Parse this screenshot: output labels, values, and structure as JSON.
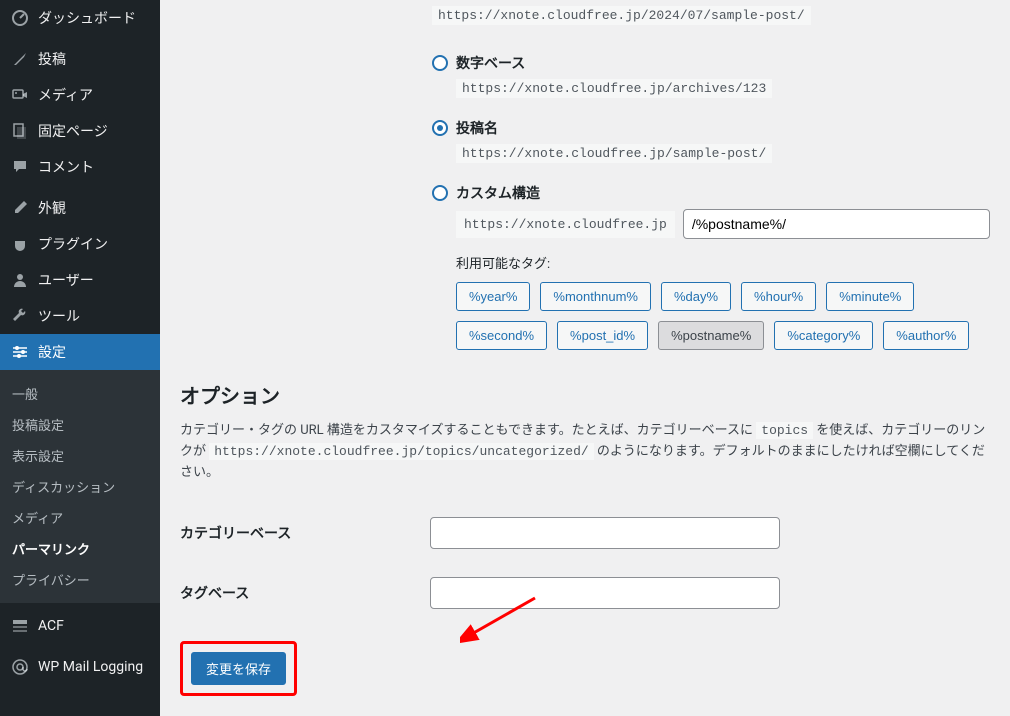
{
  "sidebar": {
    "items": [
      {
        "label": "ダッシュボード"
      },
      {
        "label": "投稿"
      },
      {
        "label": "メディア"
      },
      {
        "label": "固定ページ"
      },
      {
        "label": "コメント"
      },
      {
        "label": "外観"
      },
      {
        "label": "プラグイン"
      },
      {
        "label": "ユーザー"
      },
      {
        "label": "ツール"
      },
      {
        "label": "設定"
      },
      {
        "label": "ACF"
      },
      {
        "label": "WP Mail Logging"
      }
    ],
    "submenu": [
      {
        "label": "一般"
      },
      {
        "label": "投稿設定"
      },
      {
        "label": "表示設定"
      },
      {
        "label": "ディスカッション"
      },
      {
        "label": "メディア"
      },
      {
        "label": "パーマリンク"
      },
      {
        "label": "プライバシー"
      }
    ]
  },
  "permalinks": {
    "options": {
      "day_name_example": "https://xnote.cloudfree.jp/2024/07/sample-post/",
      "numeric_label": "数字ベース",
      "numeric_example": "https://xnote.cloudfree.jp/archives/123",
      "post_name_label": "投稿名",
      "post_name_example": "https://xnote.cloudfree.jp/sample-post/",
      "custom_label": "カスタム構造",
      "custom_base": "https://xnote.cloudfree.jp",
      "custom_value": "/%postname%/"
    },
    "tags_label": "利用可能なタグ:",
    "tags": [
      "%year%",
      "%monthnum%",
      "%day%",
      "%hour%",
      "%minute%",
      "%second%",
      "%post_id%",
      "%postname%",
      "%category%",
      "%author%"
    ],
    "active_tag": "%postname%"
  },
  "optional": {
    "heading": "オプション",
    "desc_parts": {
      "p1": "カテゴリー・タグの URL 構造をカスタマイズすることもできます。たとえば、カテゴリーベースに ",
      "code1": "topics",
      "p2": " を使えば、カテゴリーのリンクが ",
      "code2": "https://xnote.cloudfree.jp/topics/uncategorized/",
      "p3": " のようになります。デフォルトのままにしたければ空欄にしてください。"
    },
    "category_base_label": "カテゴリーベース",
    "tag_base_label": "タグベース",
    "category_base_value": "",
    "tag_base_value": ""
  },
  "submit_label": "変更を保存"
}
